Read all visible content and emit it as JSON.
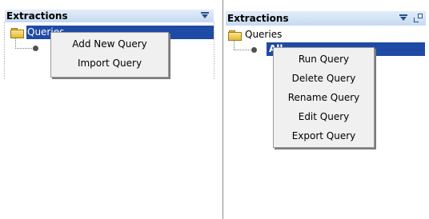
{
  "left_panel": {
    "title": "Extractions",
    "tree": {
      "root_label": "Queries"
    },
    "context_menu": {
      "items": [
        "Add New Query",
        "Import Query"
      ]
    }
  },
  "right_panel": {
    "title": "Extractions",
    "tree": {
      "root_label": "Queries",
      "child_label": "All"
    },
    "context_menu": {
      "items": [
        "Run Query",
        "Delete Query",
        "Rename Query",
        "Edit Query",
        "Export Query"
      ]
    }
  },
  "colors": {
    "selection": "#1f4aa5",
    "menu_bg": "#f0f0f0",
    "title_gradient_top": "#e3edf9",
    "title_gradient_bottom": "#c6d9f1"
  },
  "icons": [
    "folder-icon",
    "menu-icon",
    "popout-icon",
    "tree-node-dot-icon"
  ]
}
